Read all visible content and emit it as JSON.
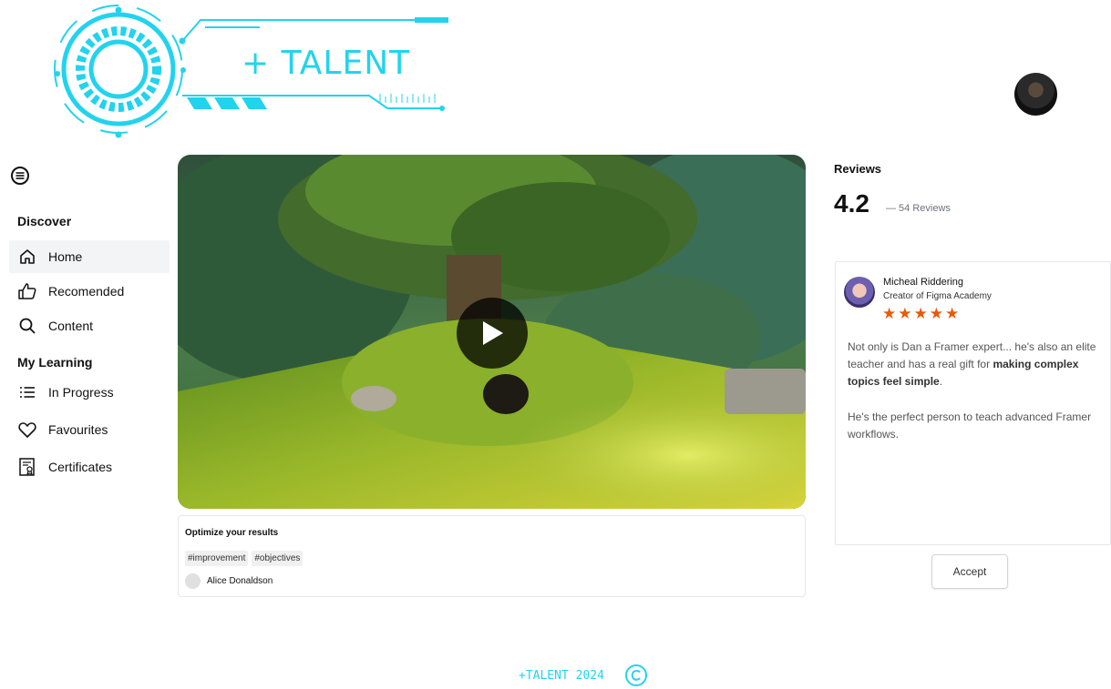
{
  "brand": {
    "logo_text": "+ TALENT",
    "accent_color": "#22d3ee"
  },
  "sidebar": {
    "discover_heading": "Discover",
    "discover_items": [
      {
        "label": "Home",
        "icon": "home-icon",
        "active": true
      },
      {
        "label": "Recomended",
        "icon": "thumbs-up-icon"
      },
      {
        "label": "Content",
        "icon": "search-icon"
      }
    ],
    "learning_heading": "My Learning",
    "learning_items": [
      {
        "label": "In Progress",
        "icon": "list-icon"
      },
      {
        "label": "Favourites",
        "icon": "heart-icon"
      },
      {
        "label": "Certificates",
        "icon": "certificate-icon"
      }
    ]
  },
  "video": {
    "title": "Optimize your results",
    "tags": [
      "#improvement",
      "#objectives"
    ],
    "author": "Alice Donaldson"
  },
  "reviews": {
    "heading": "Reviews",
    "score": "4.2",
    "count_text": "— 54 Reviews",
    "review": {
      "name": "Micheal Riddering",
      "role": "Creator of Figma Academy",
      "stars": "★★★★★",
      "rating": 5,
      "body_plain": "Not only is Dan a Framer expert... he's also an elite teacher and has a real gift for ",
      "body_bold": "making complex topics feel simple",
      "body_end": ".",
      "body_2": "He's the perfect person to teach advanced Framer workflows."
    },
    "accept_label": "Accept"
  },
  "footer": {
    "text": "+TALENT 2024",
    "icon": "copyright-icon"
  }
}
